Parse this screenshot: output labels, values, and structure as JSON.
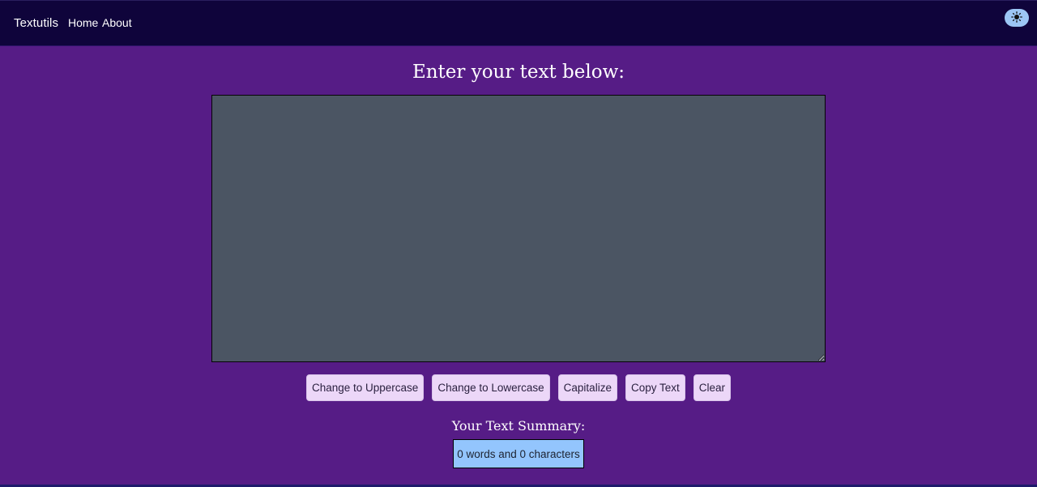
{
  "navbar": {
    "brand": "Textutils",
    "links": [
      {
        "label": "Home"
      },
      {
        "label": "About"
      }
    ],
    "theme_toggle_icon": "sun-icon"
  },
  "main": {
    "heading": "Enter your text below:",
    "textarea": {
      "value": "",
      "placeholder": ""
    },
    "buttons": [
      {
        "label": "Change to Uppercase"
      },
      {
        "label": "Change to Lowercase"
      },
      {
        "label": "Capitalize"
      },
      {
        "label": "Copy Text"
      },
      {
        "label": "Clear"
      }
    ],
    "summary": {
      "title": "Your Text Summary:",
      "text": "0 words and 0 characters"
    }
  },
  "colors": {
    "background": "#561c86",
    "navbar": "#0f043b",
    "textarea": "#4b5563",
    "button": "#ecd7f8",
    "summary_box": "#93c5fd",
    "toggle": "#9cc6f5"
  }
}
